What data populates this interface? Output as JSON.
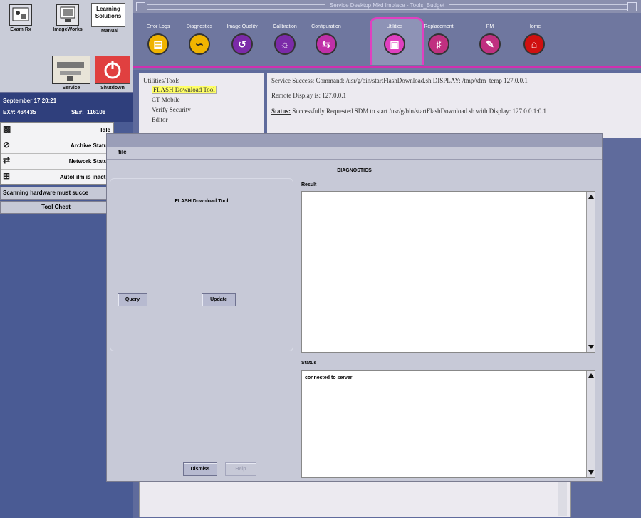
{
  "apps": [
    {
      "name": "exam-rx",
      "label": "Exam Rx"
    },
    {
      "name": "imageworks",
      "label": "ImageWorks"
    },
    {
      "name": "learning-solutions",
      "label": "Learning Solutions",
      "sublabel": "Manual"
    },
    {
      "name": "service",
      "label": "Service"
    },
    {
      "name": "shutdown",
      "label": "Shutdown"
    }
  ],
  "info": {
    "date": "September 17 20:21",
    "ex_label": "EX#:",
    "ex_value": "464435",
    "se_label": "SE#:",
    "se_value": "116108"
  },
  "status_list": [
    {
      "icon": "camera-icon",
      "text": "Idle"
    },
    {
      "icon": "archive-icon",
      "text": "Archive Status"
    },
    {
      "icon": "network-icon",
      "text": "Network Status"
    },
    {
      "icon": "autofilm-icon",
      "text": "AutoFilm is inactiv"
    }
  ],
  "scan_msg": "Scanning hardware must succe",
  "tool_chest": "Tool Chest",
  "service_window": {
    "title": "Service Desktop Mkd Implace - Tools_Budget",
    "toolbar": [
      {
        "label": "Error Logs",
        "color": "#f0b400"
      },
      {
        "label": "Diagnostics",
        "color": "#f0b400"
      },
      {
        "label": "Image Quality",
        "color": "#7b2aa8"
      },
      {
        "label": "Calibration",
        "color": "#7b2aa8"
      },
      {
        "label": "Configuration",
        "color": "#c030a8"
      },
      {
        "label": "Utilities",
        "color": "#e040c0"
      },
      {
        "label": "Replacement",
        "color": "#c03080"
      },
      {
        "label": "PM",
        "color": "#c03080"
      },
      {
        "label": "Home",
        "color": "#d01010"
      }
    ],
    "tree": {
      "root": "Utilities/Tools",
      "items": [
        "FLASH Download Tool",
        "CT Mobile",
        "Verify Security",
        "Editor"
      ]
    },
    "messages": {
      "line1": "Service Success: Command: /usr/g/bin/startFlashDownload.sh DISPLAY: /tmp/xfm_temp 127.0.0.1",
      "line2": "Remote Display is: 127.0.0.1",
      "status_label": "Status:",
      "line3": "Successfully Requested SDM to start /usr/g/bin/startFlashDownload.sh with Display: 127.0.0.1:0.1"
    }
  },
  "dialog": {
    "menu_file": "file",
    "title": "DIAGNOSTICS",
    "panel_title": "FLASH Download Tool",
    "query_label": "Query",
    "update_label": "Update",
    "dismiss_label": "Dismiss",
    "help_label": "Help",
    "result_label": "Result",
    "status_label": "Status",
    "status_text": "connected to server"
  }
}
